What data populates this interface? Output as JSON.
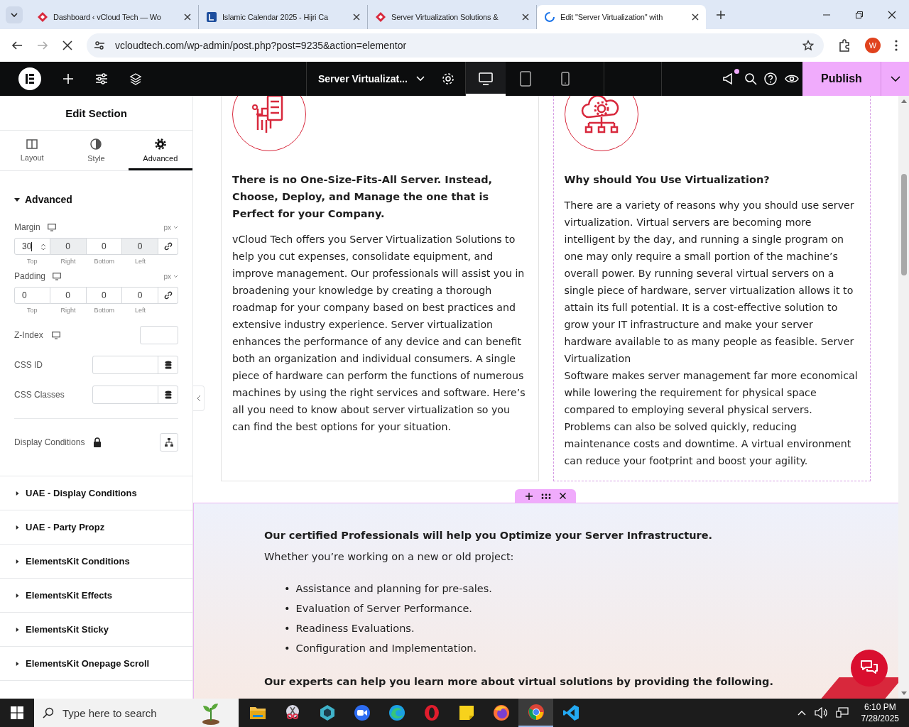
{
  "browser": {
    "tabs": [
      {
        "title": "Dashboard ‹ vCloud Tech — Wo",
        "selected": false,
        "kind": "diamond"
      },
      {
        "title": "Islamic Calendar 2025 - Hijri Ca",
        "selected": false,
        "kind": "calendar"
      },
      {
        "title": "Server Virtualization Solutions &",
        "selected": false,
        "kind": "diamond"
      },
      {
        "title": "Edit \"Server Virtualization\" with",
        "selected": true,
        "kind": "loading"
      }
    ],
    "url": "vcloudtech.com/wp-admin/post.php?post=9235&action=elementor",
    "profile_initial": "W"
  },
  "editor_bar": {
    "page_title": "Server Virtualizat...",
    "has_notification": true,
    "publish": "Publish",
    "devices": [
      {
        "kind": "desktop",
        "selected": true
      },
      {
        "kind": "tablet",
        "selected": false
      },
      {
        "kind": "mobile",
        "selected": false
      }
    ]
  },
  "panel": {
    "title": "Edit Section",
    "tabs": [
      {
        "label": "Layout",
        "kind": "columns",
        "selected": false
      },
      {
        "label": "Style",
        "kind": "contrast",
        "selected": false
      },
      {
        "label": "Advanced",
        "kind": "gear",
        "selected": true
      }
    ],
    "group": "Advanced",
    "group_expanded": true,
    "spacing": [
      {
        "label": "Margin",
        "unit": "px",
        "fields": [
          {
            "value": "30",
            "label": "Top",
            "disabled": false,
            "focused": true
          },
          {
            "value": "0",
            "label": "Right",
            "disabled": true,
            "focused": false
          },
          {
            "value": "0",
            "label": "Bottom",
            "disabled": false,
            "focused": false
          },
          {
            "value": "0",
            "label": "Left",
            "disabled": true,
            "focused": false
          }
        ]
      },
      {
        "label": "Padding",
        "unit": "px",
        "fields": [
          {
            "value": "0",
            "label": "Top",
            "disabled": false,
            "focused": false
          },
          {
            "value": "0",
            "label": "Right",
            "disabled": false,
            "focused": false
          },
          {
            "value": "0",
            "label": "Bottom",
            "disabled": false,
            "focused": false
          },
          {
            "value": "0",
            "label": "Left",
            "disabled": false,
            "focused": false
          }
        ]
      }
    ],
    "z_index": "Z-Index",
    "css_id": "CSS ID",
    "css_classes": "CSS Classes",
    "display_conditions": "Display Conditions",
    "sections": [
      {
        "label": "UAE - Display Conditions",
        "expanded": false
      },
      {
        "label": "UAE - Party Propz",
        "expanded": false
      },
      {
        "label": "ElementsKit Conditions",
        "expanded": false
      },
      {
        "label": "ElementsKit Effects",
        "expanded": false
      },
      {
        "label": "ElementsKit Sticky",
        "expanded": false
      },
      {
        "label": "ElementsKit Onepage Scroll",
        "expanded": false
      }
    ]
  },
  "columns": [
    {
      "kind": "server",
      "selected": false,
      "heading": "There is no One-Size-Fits-All Server. Instead, Choose, Deploy, and Manage the one that is Perfect for your Company.",
      "body": "vCloud Tech offers you Server Virtualization Solutions to help you cut expenses, consolidate equipment, and improve management. Our professionals will assist you in broadening your knowledge by creating a thorough roadmap for your company based on best practices and extensive industry experience. Server virtualization enhances the performance of any device and can benefit both an organization and individual consumers. A single piece of hardware can perform the functions of numerous machines by using the right services and software. Here’s all you need to know about server virtualization so you can find the best options for your situation."
    },
    {
      "kind": "cloud",
      "selected": true,
      "heading": "Why should You Use Virtualization?",
      "body": "There are a variety of reasons why you should use server virtualization. Virtual servers are becoming more intelligent by the day, and running a single program on one may only require a small portion of the machine’s overall power. By running several virtual servers on a single piece of hardware, server virtualization allows it to attain its full potential. It is a cost-effective solution to grow your IT infrastructure and make your server hardware available to as many people as feasible. Server Virtualization\nSoftware makes server management far more economical while lowering the requirement for physical space compared to employing several physical servers. Problems can also be solved quickly, reducing maintenance costs and downtime. A virtual environment can reduce your footprint and boost your agility."
    }
  ],
  "section": {
    "heading": "Our certified Professionals will help you Optimize your Server Infrastructure.",
    "intro": "Whether you’re working on a new or old project:",
    "bullet": "•",
    "items": [
      "Assistance and planning for pre-sales.",
      "Evaluation of Server Performance.",
      "Readiness Evaluations.",
      "Configuration and Implementation."
    ],
    "closing": "Our experts can help you learn more about virtual solutions by providing the following."
  },
  "taskbar": {
    "search_placeholder": "Type here to search",
    "apps": [
      {
        "kind": "folder",
        "active": false
      },
      {
        "kind": "snip",
        "active": false
      },
      {
        "kind": "gem",
        "active": false
      },
      {
        "kind": "video",
        "active": false
      },
      {
        "kind": "edge",
        "active": false
      },
      {
        "kind": "opera",
        "active": false
      },
      {
        "kind": "note",
        "active": false
      },
      {
        "kind": "firefox",
        "active": false
      },
      {
        "kind": "chrome",
        "active": true
      },
      {
        "kind": "code",
        "active": false
      }
    ],
    "time": "6:10 PM",
    "date": "7/28/2025"
  }
}
